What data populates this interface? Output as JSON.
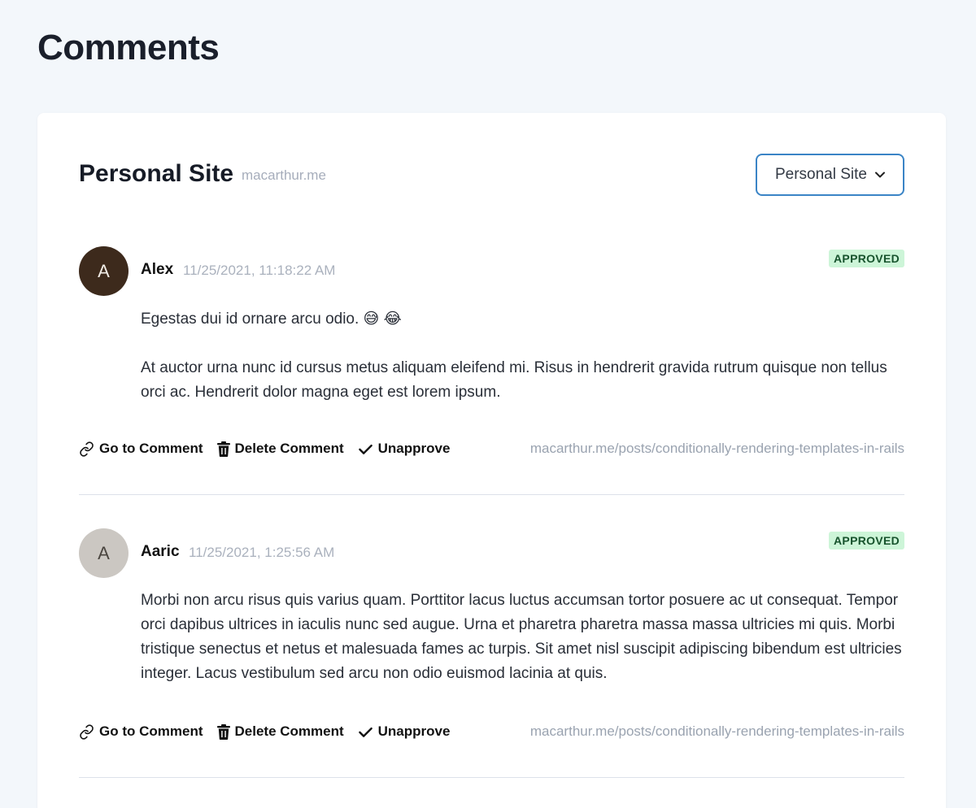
{
  "page": {
    "title": "Comments"
  },
  "site": {
    "name": "Personal Site",
    "domain": "macarthur.me",
    "selector_value": "Personal Site"
  },
  "colors": {
    "select_border": "#3a84c6",
    "badge_bg": "#cdf5d8",
    "badge_text": "#17532d"
  },
  "actions": {
    "go_to": "Go to Comment",
    "delete": "Delete Comment",
    "unapprove": "Unapprove"
  },
  "comments": [
    {
      "avatar_letter": "A",
      "avatar_color": "#3d2a1c",
      "author": "Alex",
      "timestamp": "11/25/2021, 11:18:22 AM",
      "status": "APPROVED",
      "paragraphs": [
        "Egestas dui id ornare arcu odio. 😅 😂",
        "At auctor urna nunc id cursus metus aliquam eleifend mi. Risus in hendrerit gravida rutrum quisque non tellus orci ac. Hendrerit dolor magna eget est lorem ipsum."
      ],
      "post_url": "macarthur.me/posts/conditionally-rendering-templates-in-rails"
    },
    {
      "avatar_letter": "A",
      "avatar_color": "#cbc7c2",
      "author": "Aaric",
      "timestamp": "11/25/2021, 1:25:56 AM",
      "status": "APPROVED",
      "paragraphs": [
        "Morbi non arcu risus quis varius quam. Porttitor lacus luctus accumsan tortor posuere ac ut consequat. Tempor orci dapibus ultrices in iaculis nunc sed augue. Urna et pharetra pharetra massa massa ultricies mi quis. Morbi tristique senectus et netus et malesuada fames ac turpis. Sit amet nisl suscipit adipiscing bibendum est ultricies integer. Lacus vestibulum sed arcu non odio euismod lacinia at quis."
      ],
      "post_url": "macarthur.me/posts/conditionally-rendering-templates-in-rails"
    }
  ]
}
